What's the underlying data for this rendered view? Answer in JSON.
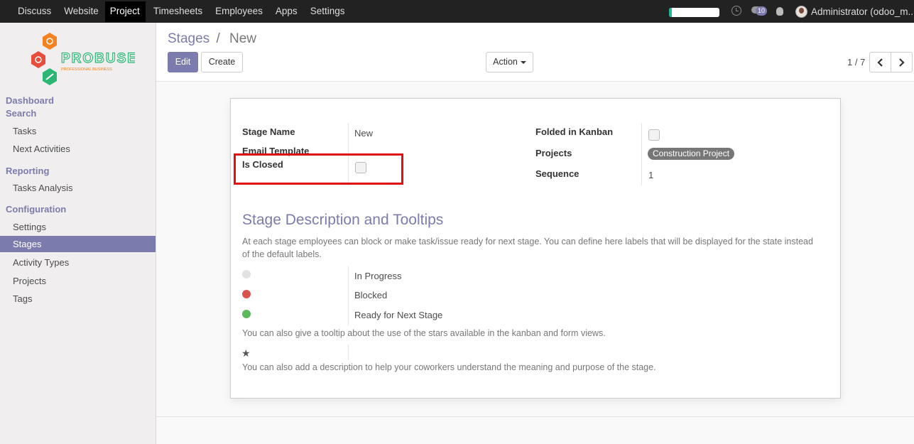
{
  "topbar": {
    "menu": [
      "Discuss",
      "Website",
      "Project",
      "Timesheets",
      "Employees",
      "Apps",
      "Settings"
    ],
    "active_menu": "Project",
    "progress_fraction": 0.06,
    "chat_count": "10",
    "user": "Administrator (odoo_m..."
  },
  "sidebar": {
    "logo_text": "PROBUSE",
    "logo_subtext": "PROFESSIONAL BUSINESS",
    "sections": [
      {
        "title": "Dashboard"
      },
      {
        "title": "Search",
        "items": [
          "Tasks",
          "Next Activities"
        ]
      },
      {
        "title": "Reporting",
        "items": [
          "Tasks Analysis"
        ]
      },
      {
        "title": "Configuration",
        "items": [
          "Settings",
          "Stages",
          "Activity Types",
          "Projects",
          "Tags"
        ]
      }
    ],
    "active_item": "Stages"
  },
  "control": {
    "breadcrumb_parent": "Stages",
    "breadcrumb_sep": "/",
    "breadcrumb_current": "New",
    "edit_label": "Edit",
    "create_label": "Create",
    "action_label": "Action",
    "pager": "1 / 7"
  },
  "form": {
    "stage_name_label": "Stage Name",
    "stage_name_value": "New",
    "email_template_label": "Email Template",
    "is_closed_label": "Is Closed",
    "is_closed_checked": false,
    "folded_label": "Folded in Kanban",
    "folded_checked": false,
    "projects_label": "Projects",
    "projects_tag": "Construction Project",
    "sequence_label": "Sequence",
    "sequence_value": "1",
    "section_title": "Stage Description and Tooltips",
    "help_1": "At each stage employees can block or make task/issue ready for next stage. You can define here labels that will be displayed for the state instead of the default labels.",
    "states": [
      {
        "label": "In Progress",
        "color": "#e2e2e2"
      },
      {
        "label": "Blocked",
        "color": "#d9534f"
      },
      {
        "label": "Ready for Next Stage",
        "color": "#5cb85c"
      }
    ],
    "help_2": "You can also give a tooltip about the use of the stars available in the kanban and form views.",
    "help_3": "You can also add a description to help your coworkers understand the meaning and purpose of the stage."
  },
  "colors": {
    "accent": "#7c7bad",
    "highlight_box": "#e01010"
  }
}
